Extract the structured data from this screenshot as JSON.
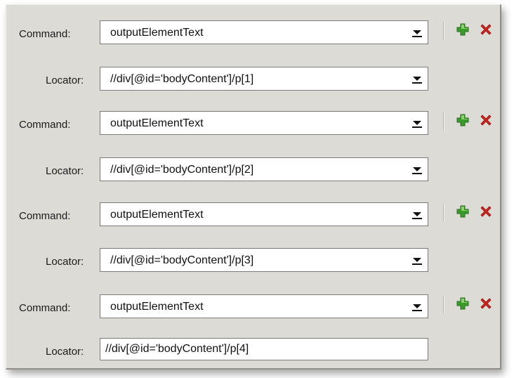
{
  "labels": {
    "command": "Command:",
    "locator": "Locator:"
  },
  "steps": [
    {
      "command": "outputElementText",
      "locator": "//div[@id='bodyContent']/p[1]"
    },
    {
      "command": "outputElementText",
      "locator": "//div[@id='bodyContent']/p[2]"
    },
    {
      "command": "outputElementText",
      "locator": "//div[@id='bodyContent']/p[3]"
    },
    {
      "command": "outputElementText",
      "locator": "//div[@id='bodyContent']/p[4]"
    }
  ],
  "colors": {
    "panel_bg": "#dcdbd6",
    "add_icon": "#3a9a2a",
    "delete_icon": "#d0241c"
  },
  "icons": {
    "add": "plus-icon",
    "delete": "cross-icon",
    "dropdown": "chevron-down-icon"
  }
}
